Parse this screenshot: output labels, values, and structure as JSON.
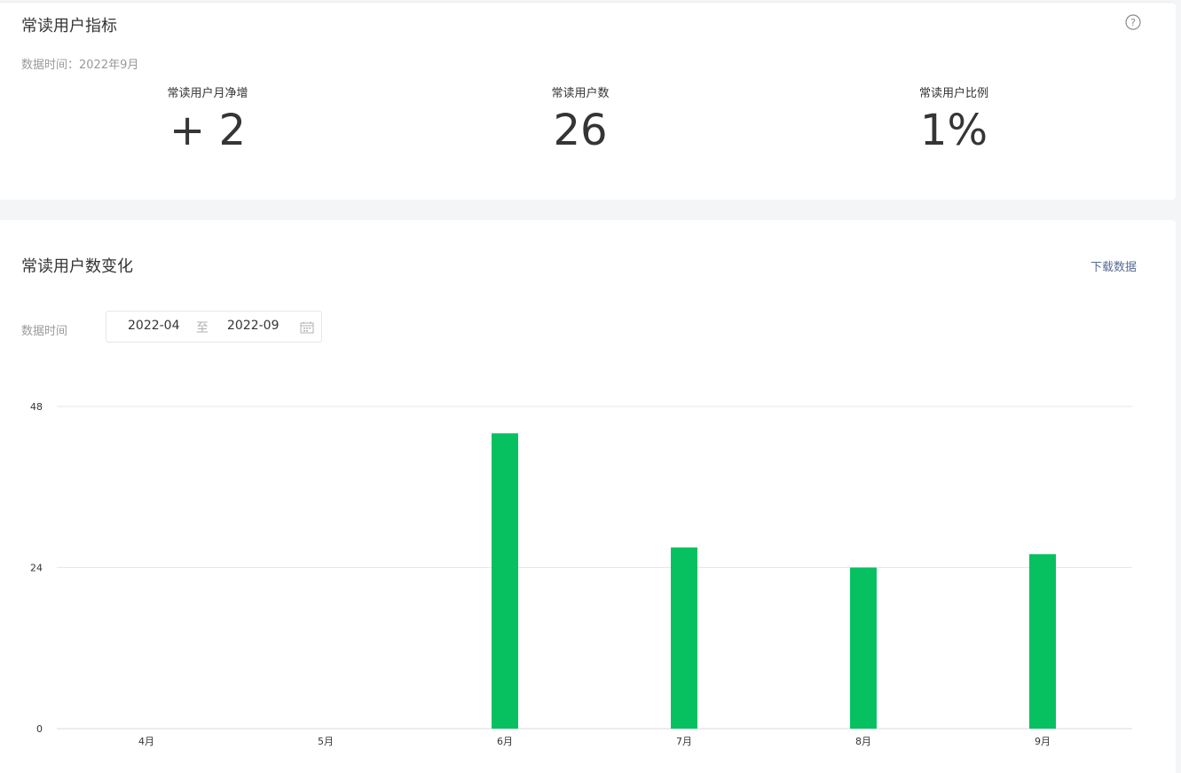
{
  "metrics_card": {
    "title": "常读用户指标",
    "help_icon": "question-circle-icon",
    "data_time": "数据时间：2022年9月",
    "metrics": [
      {
        "label": "常读用户月净增",
        "value": "+ 2"
      },
      {
        "label": "常读用户数",
        "value": "26"
      },
      {
        "label": "常读用户比例",
        "value": "1%"
      }
    ]
  },
  "trend_card": {
    "title": "常读用户数变化",
    "download_label": "下载数据",
    "range_label": "数据时间",
    "date_start": "2022-04",
    "date_separator": "至",
    "date_end": "2022-09",
    "calendar_icon": "calendar-icon"
  },
  "colors": {
    "bar": "#07c160",
    "link": "#576b95"
  },
  "chart_data": {
    "type": "bar",
    "categories": [
      "4月",
      "5月",
      "6月",
      "7月",
      "8月",
      "9月"
    ],
    "values": [
      0,
      0,
      44,
      27,
      24,
      26
    ],
    "yticks": [
      0,
      24,
      48
    ],
    "ylim": [
      0,
      48
    ],
    "grid": true
  }
}
